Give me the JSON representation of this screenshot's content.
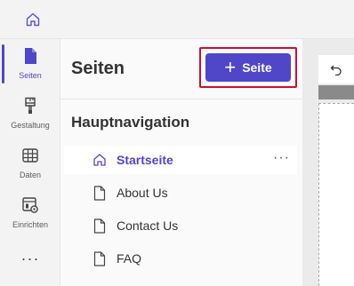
{
  "topbar": {
    "home_icon": "home-icon"
  },
  "rail": {
    "items": [
      {
        "label": "Seiten",
        "icon": "page-icon",
        "active": true
      },
      {
        "label": "Gestaltung",
        "icon": "paintbrush-icon",
        "active": false
      },
      {
        "label": "Daten",
        "icon": "table-icon",
        "active": false
      },
      {
        "label": "Einrichten",
        "icon": "settings-window-icon",
        "active": false
      }
    ],
    "more": "···"
  },
  "panel": {
    "title": "Seiten",
    "add_button": {
      "plus": "+",
      "label": "Seite"
    },
    "section_title": "Hauptnavigation",
    "items": [
      {
        "label": "Startseite",
        "icon": "home-icon",
        "selected": true,
        "more": "···"
      },
      {
        "label": "About Us",
        "icon": "page-icon",
        "selected": false
      },
      {
        "label": "Contact Us",
        "icon": "page-icon",
        "selected": false
      },
      {
        "label": "FAQ",
        "icon": "page-icon",
        "selected": false
      }
    ]
  },
  "canvas": {
    "undo_icon": "undo-icon"
  },
  "colors": {
    "accent": "#4f46c8",
    "highlight": "#c8102e"
  }
}
